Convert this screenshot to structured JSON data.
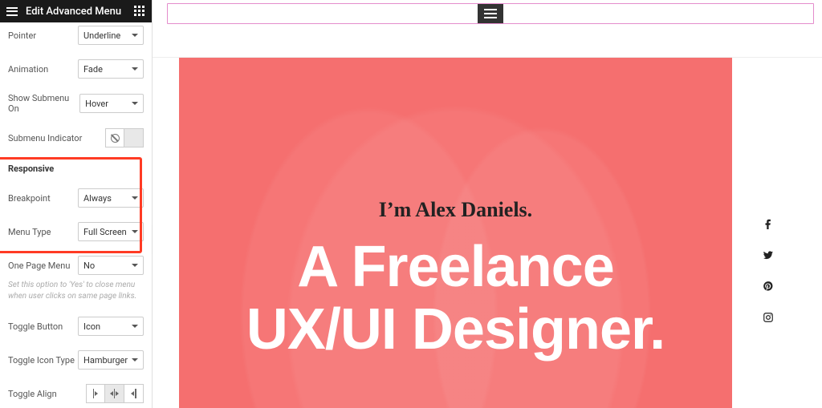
{
  "header": {
    "title": "Edit Advanced Menu"
  },
  "controls": {
    "pointer": {
      "label": "Pointer",
      "value": "Underline"
    },
    "animation": {
      "label": "Animation",
      "value": "Fade"
    },
    "show_submenu": {
      "label": "Show Submenu On",
      "value": "Hover"
    },
    "submenu_ind": {
      "label": "Submenu Indicator"
    },
    "responsive_title": "Responsive",
    "breakpoint": {
      "label": "Breakpoint",
      "value": "Always"
    },
    "menu_type": {
      "label": "Menu Type",
      "value": "Full Screen"
    },
    "one_page": {
      "label": "One Page Menu",
      "value": "No",
      "helper": "Set this option to 'Yes' to close menu when user clicks on same page links."
    },
    "toggle_button": {
      "label": "Toggle Button",
      "value": "Icon"
    },
    "toggle_icon": {
      "label": "Toggle Icon Type",
      "value": "Hamburger"
    },
    "toggle_align": {
      "label": "Toggle Align"
    }
  },
  "hero": {
    "subtitle": "I’m Alex Daniels.",
    "title_line1": "A Freelance",
    "title_line2": "UX/UI Designer."
  },
  "colors": {
    "hero_bg": "#f56f6f",
    "highlight": "#ff3b24",
    "widget_border": "#e48ccc"
  }
}
